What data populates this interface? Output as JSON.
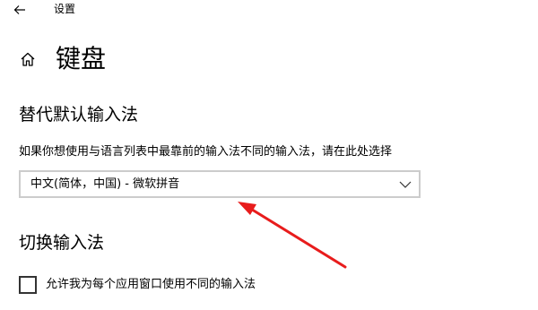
{
  "window": {
    "back_icon": "arrow-left-icon",
    "title": "设置"
  },
  "header": {
    "home_icon": "home-icon",
    "title": "键盘"
  },
  "default_input": {
    "heading": "替代默认输入法",
    "description": "如果你想使用与语言列表中最靠前的输入法不同的输入法，请在此处选择",
    "selected_value": "中文(简体，中国) - 微软拼音",
    "chevron_icon": "chevron-down-icon"
  },
  "switch_input": {
    "heading": "切换输入法",
    "checkbox_label": "允许我为每个应用窗口使用不同的输入法",
    "checked": false
  },
  "annotation": {
    "arrow_color": "#e81c1c"
  }
}
